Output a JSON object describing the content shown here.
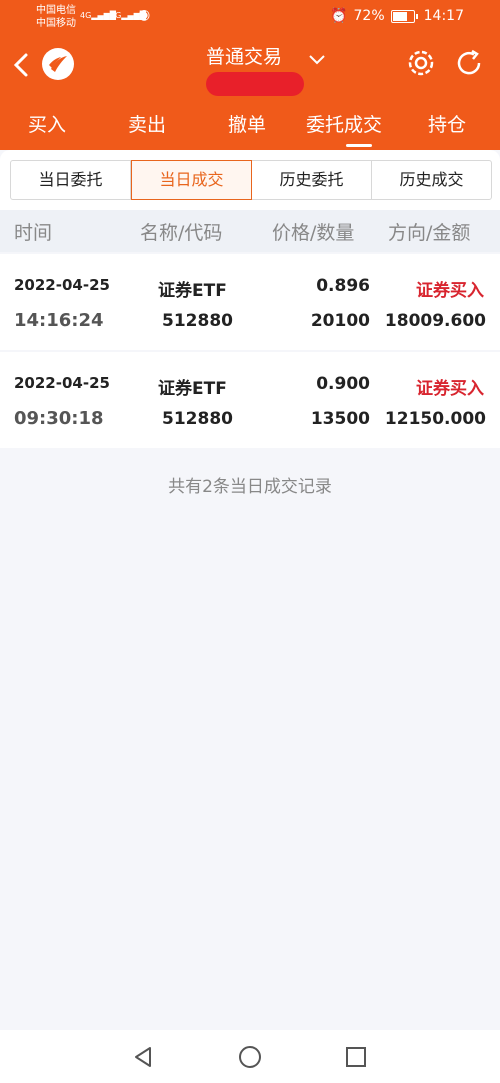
{
  "status_bar": {
    "carrier1": "中国电信",
    "carrier2": "中国移动",
    "net1": "4G",
    "net2": "4G",
    "battery": "72%",
    "time": "14:17"
  },
  "header": {
    "title": "普通交易"
  },
  "tabs": [
    {
      "label": "买入"
    },
    {
      "label": "卖出"
    },
    {
      "label": "撤单"
    },
    {
      "label": "委托成交"
    },
    {
      "label": "持仓"
    }
  ],
  "segments": [
    {
      "label": "当日委托"
    },
    {
      "label": "当日成交"
    },
    {
      "label": "历史委托"
    },
    {
      "label": "历史成交"
    }
  ],
  "columns": {
    "time": "时间",
    "name_code": "名称/代码",
    "price_qty": "价格/数量",
    "dir_amount": "方向/金额"
  },
  "rows": [
    {
      "date": "2022-04-25",
      "time": "14:16:24",
      "name": "证券ETF",
      "code": "512880",
      "price": "0.896",
      "qty": "20100",
      "direction": "证券买入",
      "amount": "18009.600"
    },
    {
      "date": "2022-04-25",
      "time": "09:30:18",
      "name": "证券ETF",
      "code": "512880",
      "price": "0.900",
      "qty": "13500",
      "direction": "证券买入",
      "amount": "12150.000"
    }
  ],
  "summary": "共有2条当日成交记录",
  "colors": {
    "brand": "#f05a1a",
    "buy": "#d8252f",
    "active_segment": "#e8651d"
  }
}
